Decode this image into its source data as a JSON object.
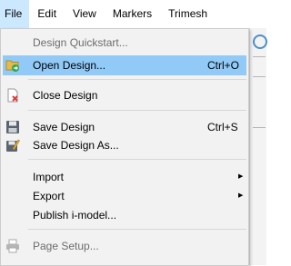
{
  "menubar": {
    "items": [
      {
        "label": "File"
      },
      {
        "label": "Edit"
      },
      {
        "label": "View"
      },
      {
        "label": "Markers"
      },
      {
        "label": "Trimesh"
      }
    ]
  },
  "file_menu": {
    "design_quickstart": {
      "label": "Design Quickstart...",
      "enabled": false
    },
    "open_design": {
      "label": "Open Design...",
      "shortcut": "Ctrl+O",
      "icon": "open-folder-icon",
      "highlighted": true
    },
    "close_design": {
      "label": "Close Design",
      "icon": "close-document-icon"
    },
    "save_design": {
      "label": "Save Design",
      "shortcut": "Ctrl+S",
      "icon": "floppy-disk-icon"
    },
    "save_design_as": {
      "label": "Save Design As...",
      "icon": "save-as-icon"
    },
    "import": {
      "label": "Import",
      "submenu": true
    },
    "export": {
      "label": "Export",
      "submenu": true
    },
    "publish": {
      "label": "Publish i-model..."
    },
    "page_setup": {
      "label": "Page Setup...",
      "icon": "printer-icon",
      "enabled": false
    }
  },
  "colors": {
    "menubar_active": "#cce8ff",
    "item_highlight": "#91c9f7",
    "menu_background": "#f2f2f2"
  }
}
